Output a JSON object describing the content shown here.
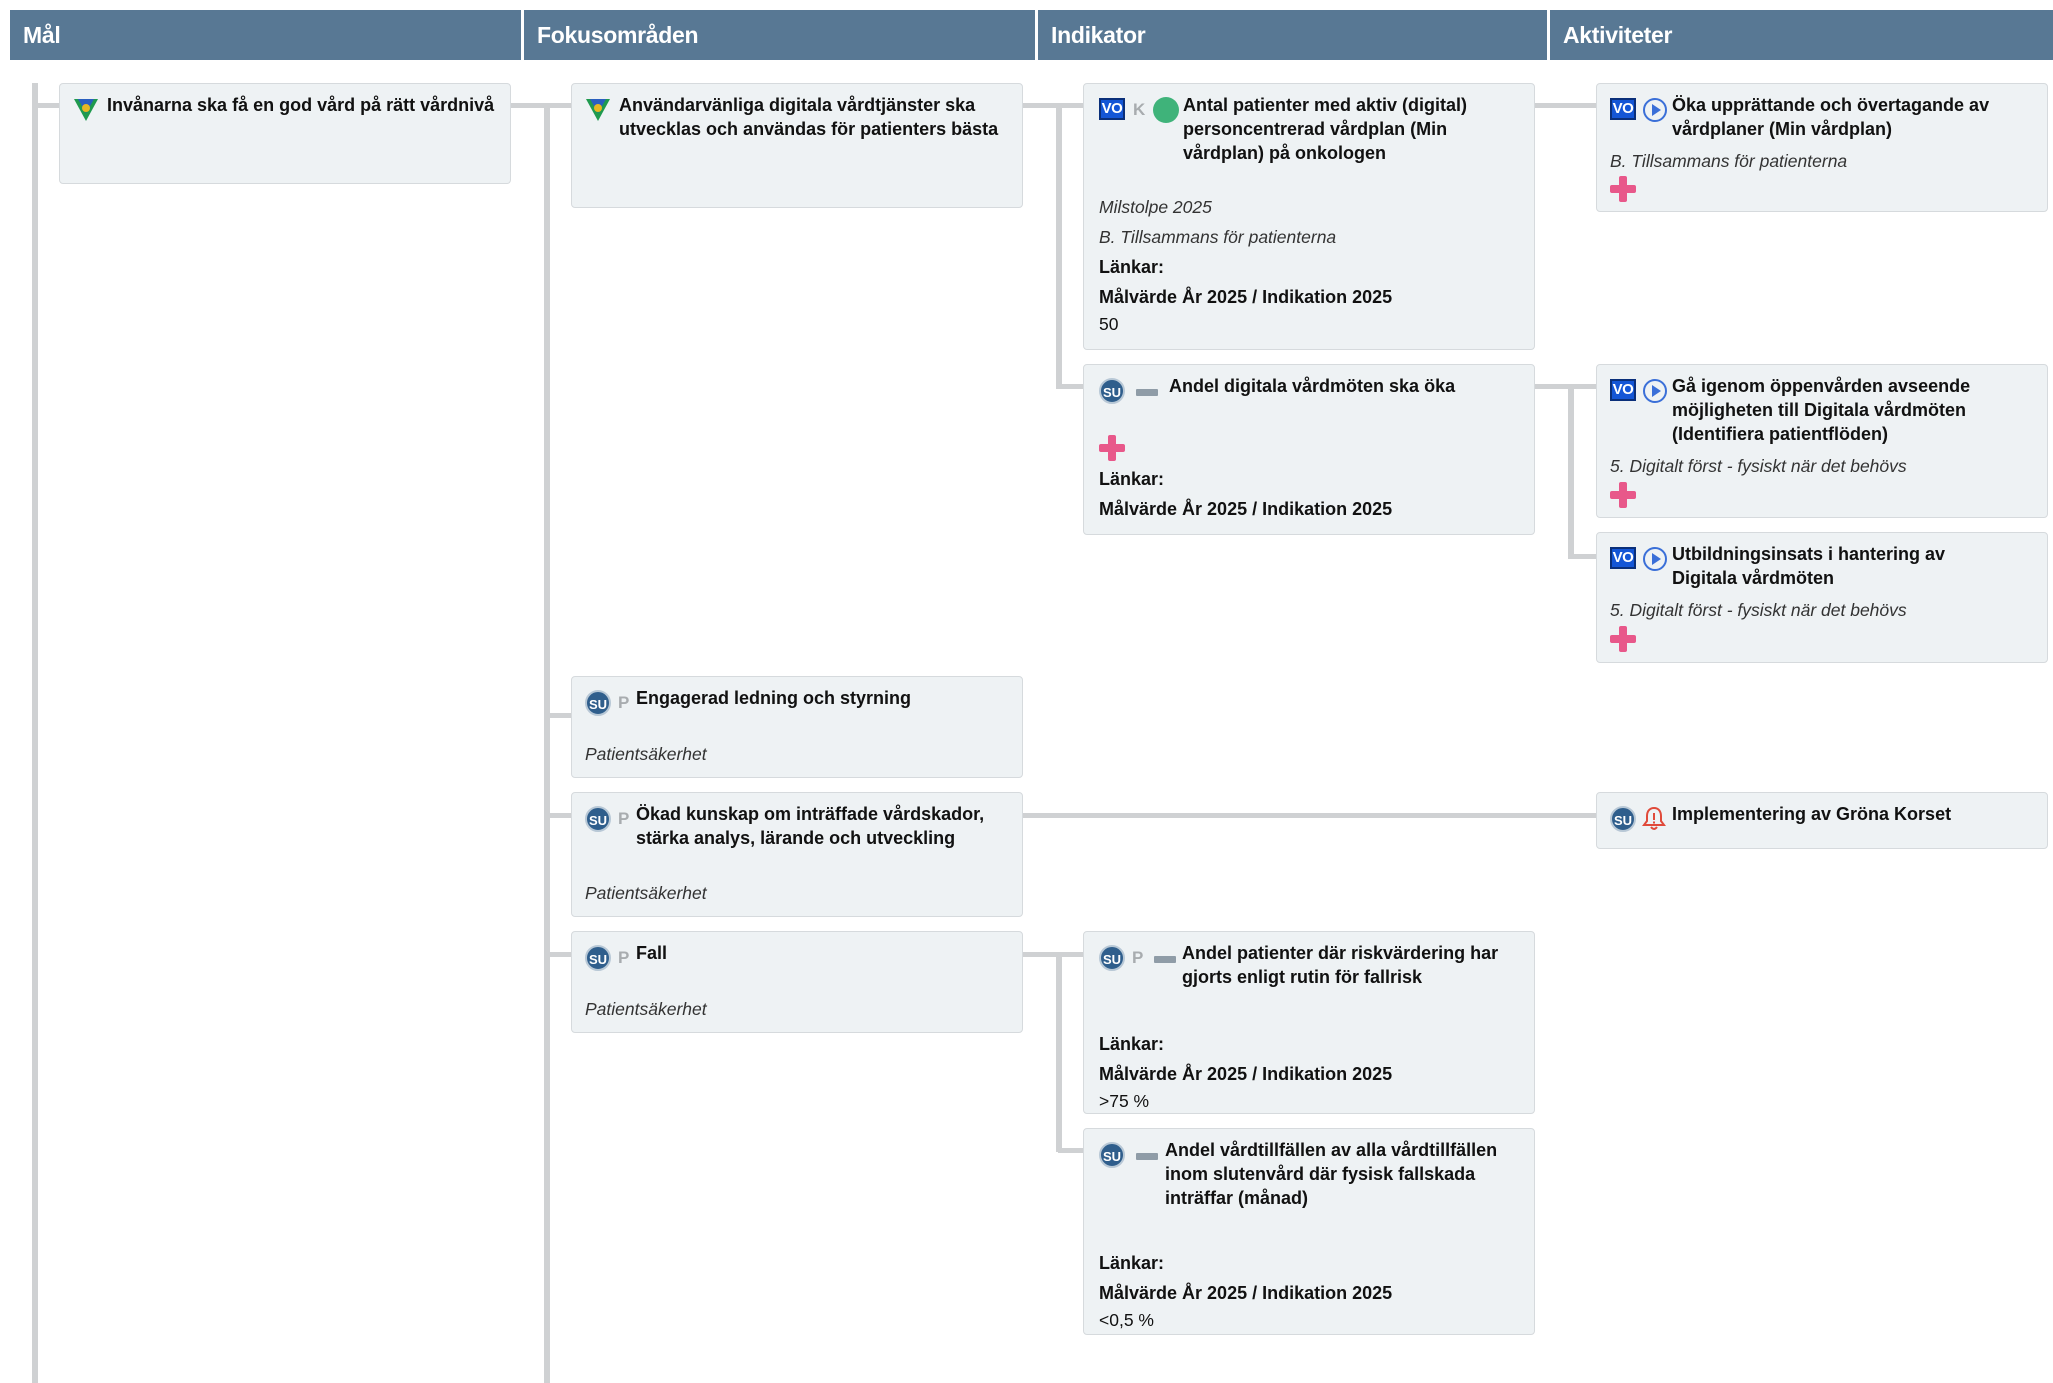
{
  "headers": [
    "Mål",
    "Fokusområden",
    "Indikator",
    "Aktiviteter"
  ],
  "colors": {
    "header_bg": "#587894",
    "card_bg": "#eef2f4",
    "connector": "#cfd1d3",
    "plus": "#e8588a",
    "status_green": "#3fb37a",
    "vo_blue": "#1456d6",
    "su_blue": "#2f5e8c"
  },
  "goal": {
    "title": "Invånarna ska få en god vård på rätt vårdnivå",
    "icon": "region-logo-icon"
  },
  "focus": [
    {
      "title": "Användarvänliga digitala vårdtjänster ska utvecklas och användas för patienters bästa",
      "icon": "region-logo-icon"
    },
    {
      "title": "Engagerad ledning och styrning",
      "badge": "SU",
      "letter": "P",
      "category": "Patientsäkerhet"
    },
    {
      "title": "Ökad kunskap om inträffade vårdskador, stärka analys, lärande och utveckling",
      "badge": "SU",
      "letter": "P",
      "category": "Patientsäkerhet"
    },
    {
      "title": "Fall",
      "badge": "SU",
      "letter": "P",
      "category": "Patientsäkerhet"
    }
  ],
  "indicators": [
    {
      "badge": "VO",
      "letter": "K",
      "status": "green-dot",
      "title": "Antal patienter med aktiv (digital) personcentrerad vårdplan (Min vårdplan) på onkologen",
      "milestone": "Milstolpe 2025",
      "category": "B. Tillsammans för patienterna",
      "links_label": "Länkar:",
      "target_label": "Målvärde År 2025 / Indikation 2025",
      "target_value": "50"
    },
    {
      "badge": "SU",
      "title": "Andel digitala vårdmöten ska öka",
      "links_label": "Länkar:",
      "target_label": "Målvärde År 2025 / Indikation 2025"
    },
    {
      "badge": "SU",
      "letter": "P",
      "title": "Andel patienter där riskvärdering har gjorts enligt rutin för fallrisk",
      "links_label": "Länkar:",
      "target_label": "Målvärde År 2025 / Indikation 2025",
      "target_value": ">75 %"
    },
    {
      "badge": "SU",
      "title": "Andel vårdtillfällen av alla vårdtillfällen inom slutenvård där fysisk fallskada inträffar (månad)",
      "links_label": "Länkar:",
      "target_label": "Målvärde År 2025 / Indikation 2025",
      "target_value": "<0,5 %"
    }
  ],
  "activities": [
    {
      "badge": "VO",
      "icon": "play-circle-icon",
      "title": "Öka upprättande och övertagande av vårdplaner (Min vårdplan)",
      "category": "B. Tillsammans för patienterna"
    },
    {
      "badge": "VO",
      "icon": "play-circle-icon",
      "title": "Gå igenom öppenvården avseende möjligheten till Digitala vårdmöten (Identifiera patientflöden)",
      "category": "5. Digitalt först - fysiskt när det behövs"
    },
    {
      "badge": "VO",
      "icon": "play-circle-icon",
      "title": "Utbildningsinsats i hantering av Digitala vårdmöten",
      "category": "5. Digitalt först - fysiskt när det behövs"
    },
    {
      "badge": "SU",
      "icon": "alert-bell-icon",
      "title": "Implementering av Gröna Korset"
    }
  ]
}
